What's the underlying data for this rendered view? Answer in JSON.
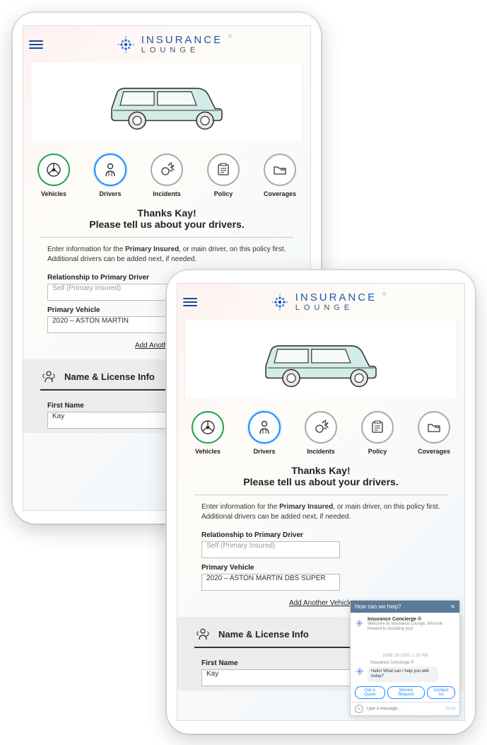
{
  "brand": {
    "line1": "INSURANCE",
    "line2": "LOUNGE",
    "reg": "®"
  },
  "steps": [
    {
      "label": "Vehicles",
      "state": "done",
      "icon": "wheel"
    },
    {
      "label": "Drivers",
      "state": "active",
      "icon": "person"
    },
    {
      "label": "Incidents",
      "state": "",
      "icon": "burst"
    },
    {
      "label": "Policy",
      "state": "",
      "icon": "doc"
    },
    {
      "label": "Coverages",
      "state": "",
      "icon": "folder"
    }
  ],
  "title": {
    "line1": "Thanks Kay!",
    "line2": "Please tell us about your drivers."
  },
  "instructions": {
    "prefix": "Enter information for the ",
    "bold": "Primary Insured",
    "suffix": ", or main driver, on this policy first. Additional drivers can be added next, if needed."
  },
  "form": {
    "relationship_label": "Relationship to Primary Driver",
    "relationship_value": "Self (Primary Insured)",
    "vehicle_label": "Primary Vehicle",
    "vehicle_value_short": "2020 – ASTON MARTIN",
    "vehicle_value_full": "2020 – ASTON MARTIN DBS SUPER",
    "add_another": "Add Another Vehicle"
  },
  "section": {
    "title": "Name & License Info",
    "first_name_label": "First Name",
    "first_name_value": "Kay"
  },
  "chat": {
    "header": "How can we help?",
    "title": "Insurance Concierge ®",
    "subtitle": "Welcome to Insurance Lounge. We look forward to assisting you!",
    "date": "JUNE 26 2020, 1:28 PM",
    "agent_name": "Insurance Concierge ®",
    "message": "Hello! What can I help you with today?",
    "buttons": [
      "Get a Quote",
      "Service Request",
      "Contact Us"
    ],
    "placeholder": "Type a message...",
    "send": "Send"
  }
}
